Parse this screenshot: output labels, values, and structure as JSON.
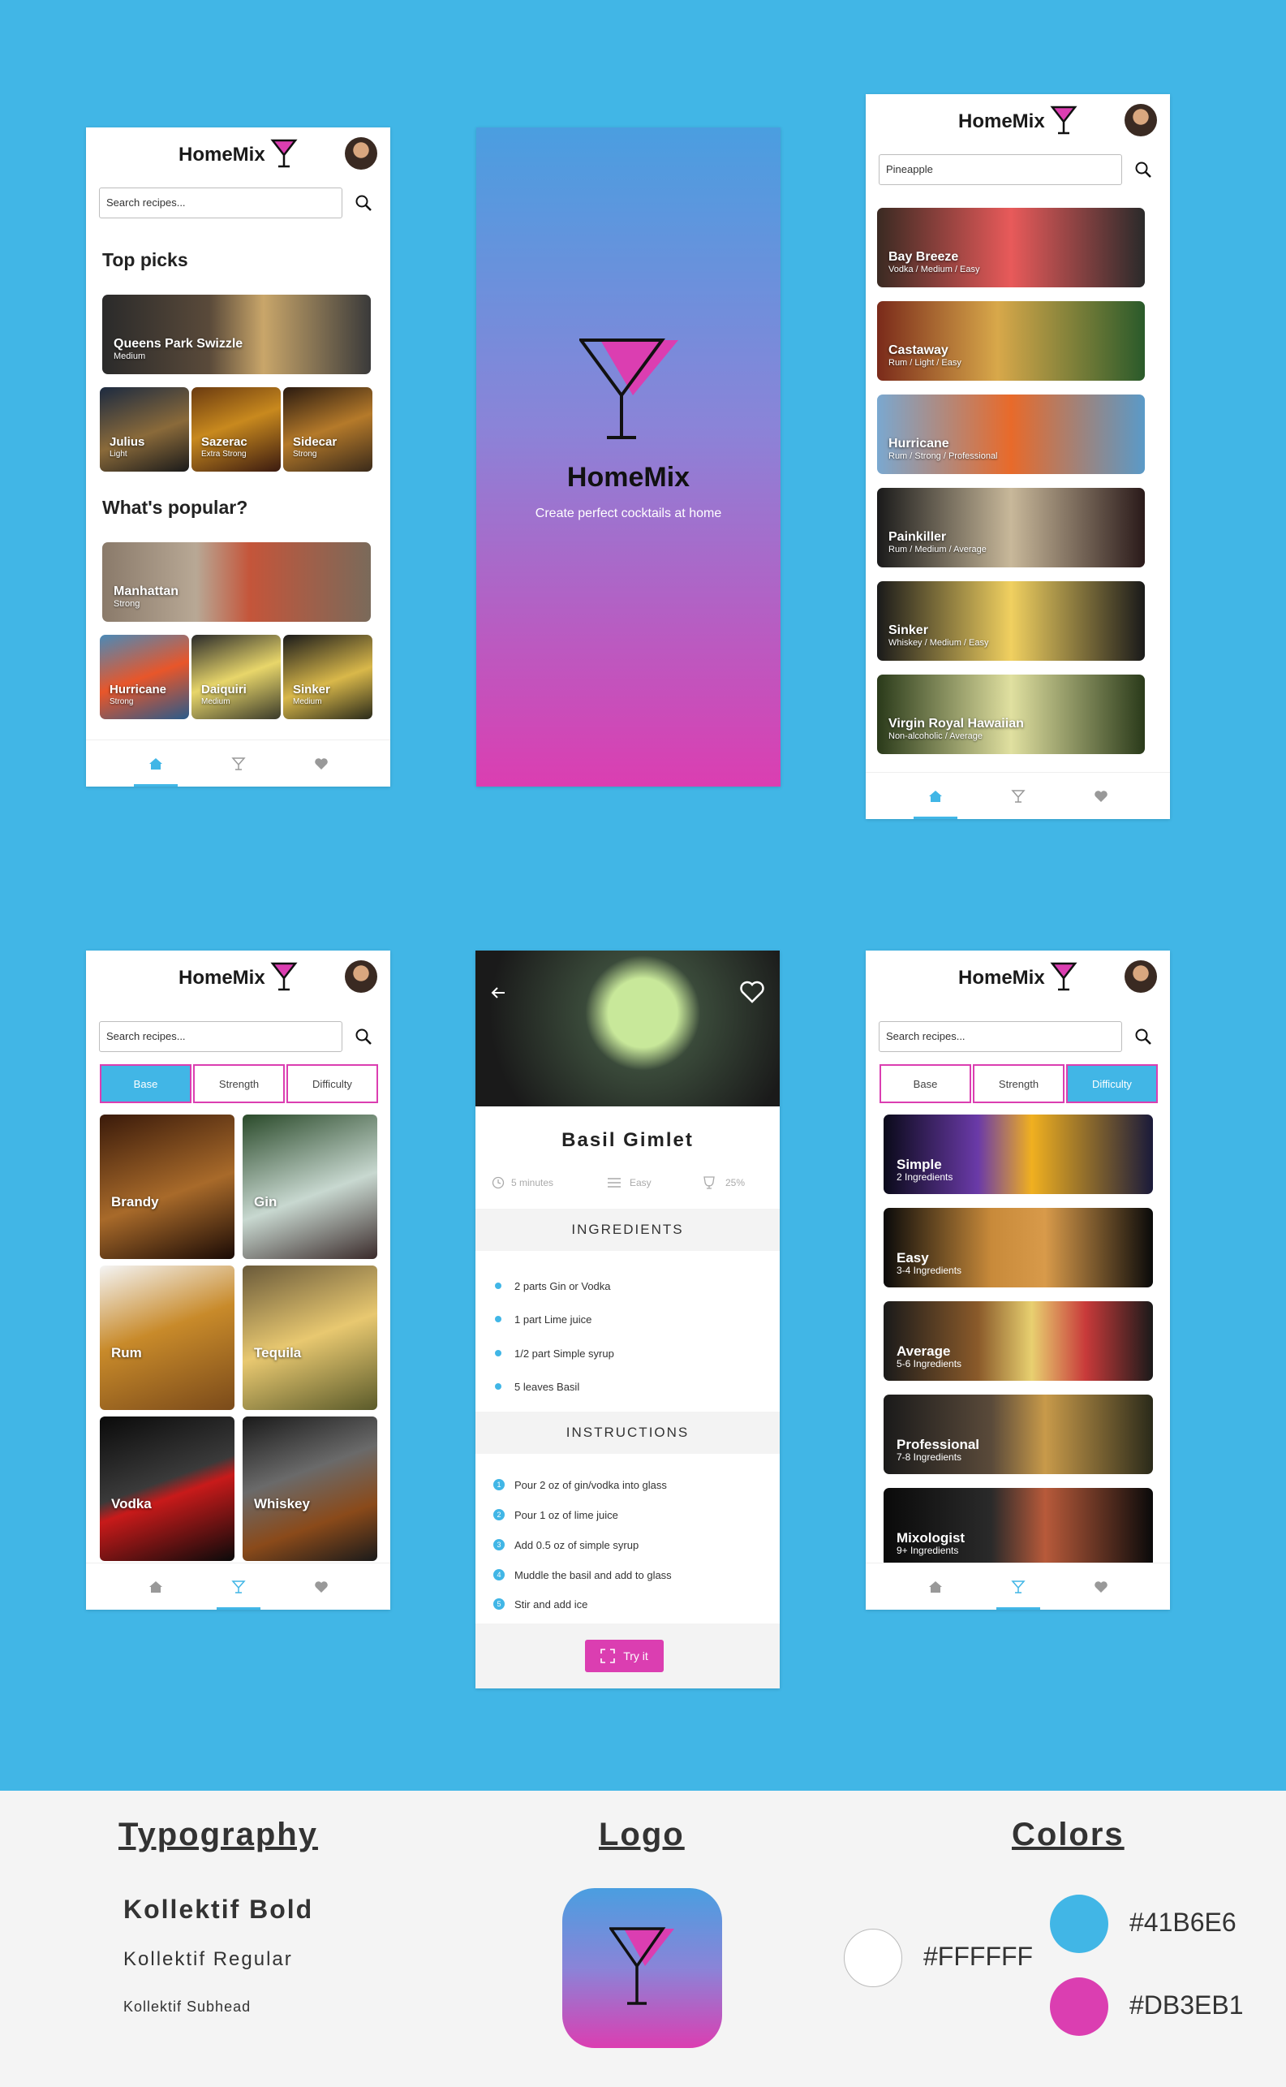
{
  "app": {
    "name": "HomeMix",
    "tagline": "Create perfect cocktails at home"
  },
  "search": {
    "placeholder": "Search recipes...",
    "value_screen3": "Pineapple"
  },
  "home": {
    "top_picks_title": "Top picks",
    "popular_title": "What's popular?",
    "featured": {
      "name": "Queens Park Swizzle",
      "sub": "Medium"
    },
    "top_small": [
      {
        "name": "Julius",
        "sub": "Light"
      },
      {
        "name": "Sazerac",
        "sub": "Extra Strong"
      },
      {
        "name": "Sidecar",
        "sub": "Strong"
      }
    ],
    "popular_featured": {
      "name": "Manhattan",
      "sub": "Strong"
    },
    "popular_small": [
      {
        "name": "Hurricane",
        "sub": "Strong"
      },
      {
        "name": "Daiquiri",
        "sub": "Medium"
      },
      {
        "name": "Sinker",
        "sub": "Medium"
      }
    ]
  },
  "results": [
    {
      "name": "Bay Breeze",
      "sub": "Vodka / Medium / Easy"
    },
    {
      "name": "Castaway",
      "sub": "Rum / Light / Easy"
    },
    {
      "name": "Hurricane",
      "sub": "Rum / Strong / Professional"
    },
    {
      "name": "Painkiller",
      "sub": "Rum / Medium / Average"
    },
    {
      "name": "Sinker",
      "sub": "Whiskey / Medium / Easy"
    },
    {
      "name": "Virgin Royal Hawaiian",
      "sub": "Non-alcoholic / Average"
    }
  ],
  "filters": {
    "base": "Base",
    "strength": "Strength",
    "difficulty": "Difficulty"
  },
  "bases": [
    "Brandy",
    "Gin",
    "Rum",
    "Tequila",
    "Vodka",
    "Whiskey"
  ],
  "difficulties": [
    {
      "name": "Simple",
      "sub": "2 Ingredients"
    },
    {
      "name": "Easy",
      "sub": "3-4 Ingredients"
    },
    {
      "name": "Average",
      "sub": "5-6 Ingredients"
    },
    {
      "name": "Professional",
      "sub": "7-8 Ingredients"
    },
    {
      "name": "Mixologist",
      "sub": "9+ Ingredients"
    }
  ],
  "detail": {
    "title": "Basil Gimlet",
    "time": "5 minutes",
    "difficulty": "Easy",
    "strength": "25%",
    "ingredients_title": "INGREDIENTS",
    "ingredients": [
      "2 parts Gin or Vodka",
      "1 part Lime juice",
      "1/2 part Simple syrup",
      "5 leaves Basil"
    ],
    "instructions_title": "INSTRUCTIONS",
    "instructions": [
      "Pour 2 oz of gin/vodka into glass",
      "Pour 1 oz of lime juice",
      "Add 0.5 oz of simple syrup",
      "Muddle the basil and add to glass",
      "Stir and add ice"
    ],
    "step_numbers": [
      "1",
      "2",
      "3",
      "4",
      "5"
    ],
    "try_label": "Try it"
  },
  "guide": {
    "typography_title": "Typography",
    "logo_title": "Logo",
    "colors_title": "Colors",
    "font_bold": "Kollektif Bold",
    "font_regular": "Kollektif Regular",
    "font_subhead": "Kollektif Subhead",
    "colors": {
      "white": "#FFFFFF",
      "blue": "#41B6E6",
      "pink": "#DB3EB1"
    }
  },
  "icons": [
    "home-icon",
    "cocktail-icon",
    "heart-icon",
    "search-icon",
    "back-arrow-icon",
    "clock-icon",
    "list-icon",
    "glass-icon",
    "scan-icon"
  ]
}
